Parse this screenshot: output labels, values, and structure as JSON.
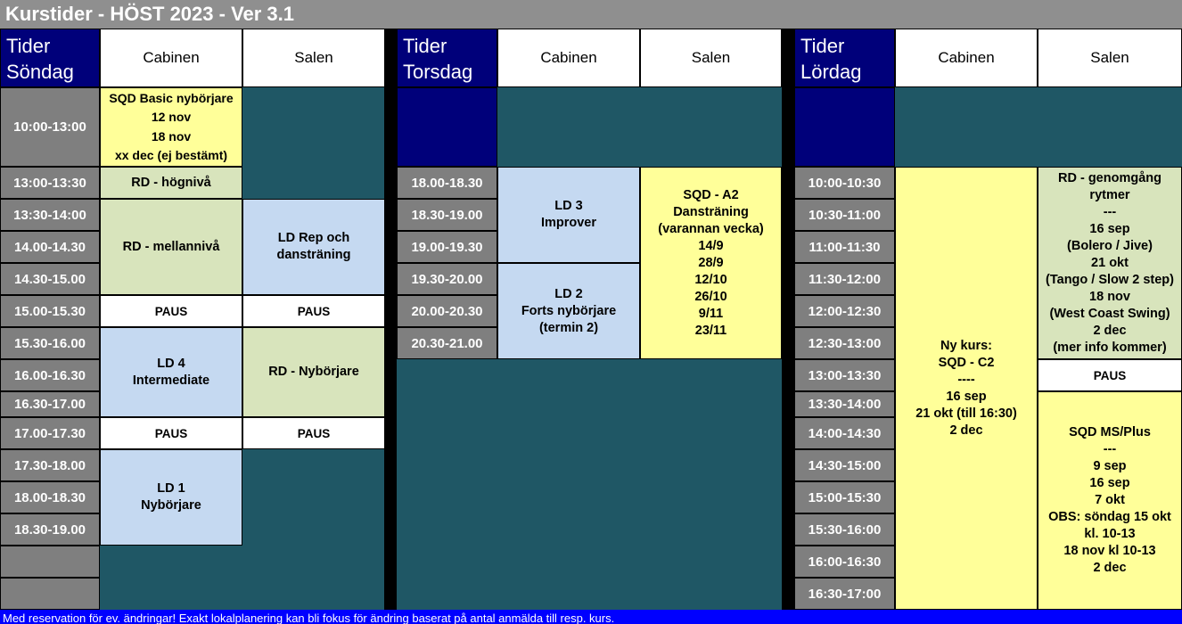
{
  "title": "Kurstider - HÖST 2023 - Ver 3.1",
  "footer": "Med reservation för ev. ändringar! Exakt lokalplanering kan bli fokus för ändring baserat på antal anmälda till resp. kurs.",
  "colors": {
    "title_bg": "#8f8f8f",
    "header_tider_bg": "#00007a",
    "time_bg": "#7f7f7f",
    "empty_bg": "#1f5765",
    "yellow": "#ffff99",
    "green": "#d8e4bc",
    "blue": "#c5d9f1",
    "footer_bg": "#0000ff"
  },
  "sondag": {
    "tider_line1": "Tider",
    "tider_line2": "Söndag",
    "room1": "Cabinen",
    "room2": "Salen",
    "times": [
      "10:00-13:00",
      "13:00-13:30",
      "13:30-14:00",
      "14.00-14.30",
      "14.30-15.00",
      "15.00-15.30",
      "15.30-16.00",
      "16.00-16.30",
      "16.30-17.00",
      "17.00-17.30",
      "17.30-18.00",
      "18.00-18.30",
      "18.30-19.00"
    ],
    "sqd_basic": [
      "SQD Basic nybörjare",
      "12 nov",
      "18 nov",
      "xx dec (ej bestämt)"
    ],
    "rd_hogniva": "RD - högnivå",
    "rd_mellanniva": "RD - mellannivå",
    "ld_rep": [
      "LD Rep och",
      "dansträning"
    ],
    "paus1_cabinen": "PAUS",
    "paus1_salen": "PAUS",
    "ld4": [
      "LD 4",
      "Intermediate"
    ],
    "rd_nyborjare": "RD - Nybörjare",
    "paus2_cabinen": "PAUS",
    "paus2_salen": "PAUS",
    "ld1": [
      "LD 1",
      "Nybörjare"
    ]
  },
  "torsdag": {
    "tider_line1": "Tider",
    "tider_line2": "Torsdag",
    "room1": "Cabinen",
    "room2": "Salen",
    "times": [
      "18.00-18.30",
      "18.30-19.00",
      "19.00-19.30",
      "19.30-20.00",
      "20.00-20.30",
      "20.30-21.00"
    ],
    "ld3": [
      "LD 3",
      "Improver"
    ],
    "ld2": [
      "LD 2",
      "Forts nybörjare",
      "(termin 2)"
    ],
    "sqd_a2": [
      "SQD - A2",
      "Dansträning",
      "(varannan vecka)",
      "14/9",
      "28/9",
      "12/10",
      "26/10",
      "9/11",
      "23/11"
    ]
  },
  "lordag": {
    "tider_line1": "Tider",
    "tider_line2": "Lördag",
    "room1": "Cabinen",
    "room2": "Salen",
    "times": [
      "10:00-10:30",
      "10:30-11:00",
      "11:00-11:30",
      "11:30-12:00",
      "12:00-12:30",
      "12:30-13:00",
      "13:00-13:30",
      "13:30-14:00",
      "14:00-14:30",
      "14:30-15:00",
      "15:00-15:30",
      "15:30-16:00",
      "16:00-16:30",
      "16:30-17:00"
    ],
    "ny_kurs": [
      "Ny kurs:",
      "SQD - C2",
      "----",
      "16 sep",
      "21 okt (till 16:30)",
      "2 dec"
    ],
    "rd_genomgang": [
      "RD - genomgång",
      "rytmer",
      "---",
      "16 sep",
      "(Bolero / Jive)",
      "21 okt",
      "(Tango / Slow 2 step)",
      "18 nov",
      "(West Coast Swing)",
      "2 dec",
      "(mer info kommer)"
    ],
    "paus": "PAUS",
    "sqd_ms": [
      "SQD MS/Plus",
      "---",
      "9 sep",
      "16 sep",
      "7 okt",
      "OBS: söndag 15 okt",
      "kl. 10-13",
      "18 nov kl 10-13",
      "2 dec"
    ]
  }
}
